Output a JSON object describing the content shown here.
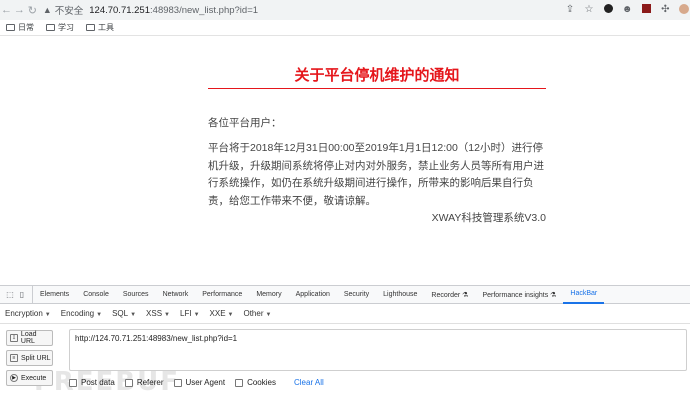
{
  "browser": {
    "insecure_label": "不安全",
    "url_host": "124.70.71.251",
    "url_path": ":48983/new_list.php?id=1",
    "bookmarks": [
      {
        "label": "日常"
      },
      {
        "label": "学习"
      },
      {
        "label": "工具"
      }
    ]
  },
  "notice": {
    "title": "关于平台停机维护的通知",
    "greeting": "各位平台用户：",
    "body": "平台将于2018年12月31日00:00至2019年1月1日12:00（12小时）进行停机升级，升级期间系统将停止对内对外服务，禁止业务人员等所有用户进行系统操作，如仍在系统升级期间进行操作，所带来的影响后果自行负责，给您工作带来不便，敬请谅解。",
    "signature": "XWAY科技管理系统V3.0",
    "accent_color": "#e5161b"
  },
  "devtools": {
    "tabs": [
      "Elements",
      "Console",
      "Sources",
      "Network",
      "Performance",
      "Memory",
      "Application",
      "Security",
      "Lighthouse",
      "Recorder ⚗",
      "Performance insights ⚗",
      "HackBar"
    ],
    "active_tab": "HackBar"
  },
  "hackbar": {
    "menus": [
      "Encryption",
      "Encoding",
      "SQL",
      "XSS",
      "LFI",
      "XXE",
      "Other"
    ],
    "load_url": "Load URL",
    "split_url": "Split URL",
    "execute": "Execute",
    "url_value": "http://124.70.71.251:48983/new_list.php?id=1",
    "options": [
      "Post data",
      "Referer",
      "User Agent",
      "Cookies"
    ],
    "clear_all": "Clear All"
  },
  "watermark": "FREEBUF"
}
